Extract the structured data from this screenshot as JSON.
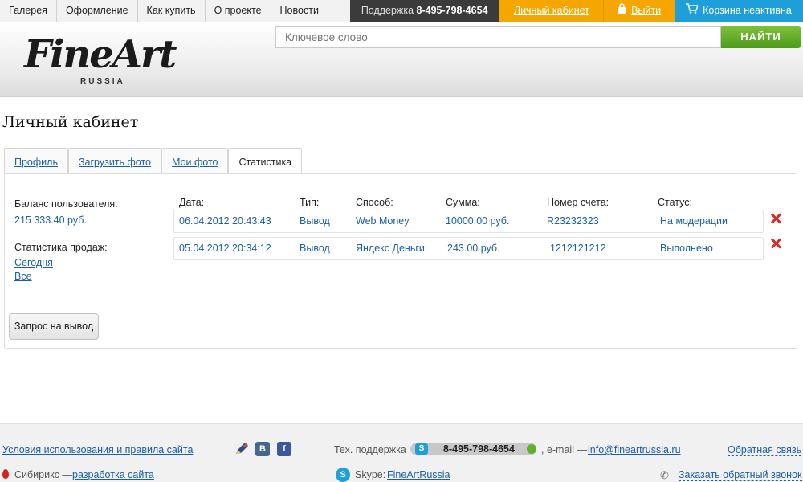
{
  "topnav": {
    "items": [
      "Галерея",
      "Оформление",
      "Как купить",
      "О проекте",
      "Новости"
    ],
    "support_label": "Поддержка",
    "support_phone": "8-495-798-4654",
    "cabinet": "Личный кабинет",
    "logout": "Выйти",
    "cart": "Корзина неактивна"
  },
  "header": {
    "logo_text": "FineArt",
    "logo_sub": "RUSSIA",
    "search_placeholder": "Ключевое слово",
    "search_button": "НАЙТИ"
  },
  "page": {
    "title": "Личный кабинет"
  },
  "tabs": [
    "Профиль",
    "Загрузить фото",
    "Мои фото",
    "Статистика"
  ],
  "tabs_active": "Статистика",
  "sidebar": {
    "balance_label": "Баланс пользователя:",
    "balance_value": "215 333.40 руб.",
    "sales_label": "Статистика продаж:",
    "link_today": "Сегодня",
    "link_all": "Все",
    "withdraw_button": "Запрос на вывод"
  },
  "table": {
    "headers": [
      "Дата:",
      "Тип:",
      "Способ:",
      "Сумма:",
      "Номер счета:",
      "Статус:"
    ],
    "rows": [
      [
        "06.04.2012 20:43:43",
        "Вывод",
        "Web Money",
        "10000.00 руб.",
        "R23232323",
        "На модерации"
      ],
      [
        "05.04.2012 20:34:12",
        "Вывод",
        "Яндекс Деньги",
        "243.00 руб.",
        "1212121212",
        "Выполнено"
      ]
    ]
  },
  "footer": {
    "terms": "Условия использования и правила сайта",
    "support_label": "Тех. поддержка",
    "support_phone": "8-495-798-4654",
    "email_label": ", e-mail —",
    "email": "info@fineartrussia.ru",
    "feedback": "Обратная связь",
    "dev_label": "Сибирикс —",
    "dev_link": "разработка сайта",
    "skype_label": "Skype:",
    "skype_name": "FineArtRussia",
    "callback": "Заказать обратный звонок"
  },
  "colors": {
    "accent_orange": "#f6a600",
    "accent_blue": "#1e9fd9",
    "search_green": "#5ea72b",
    "link": "#1a5fa8",
    "delete_red": "#d62b2b"
  },
  "icons": [
    "lock-icon",
    "cart-icon",
    "pen-icon",
    "vk-icon",
    "facebook-icon",
    "skype-icon",
    "phone-icon",
    "delete-icon",
    "sibirix-icon"
  ]
}
